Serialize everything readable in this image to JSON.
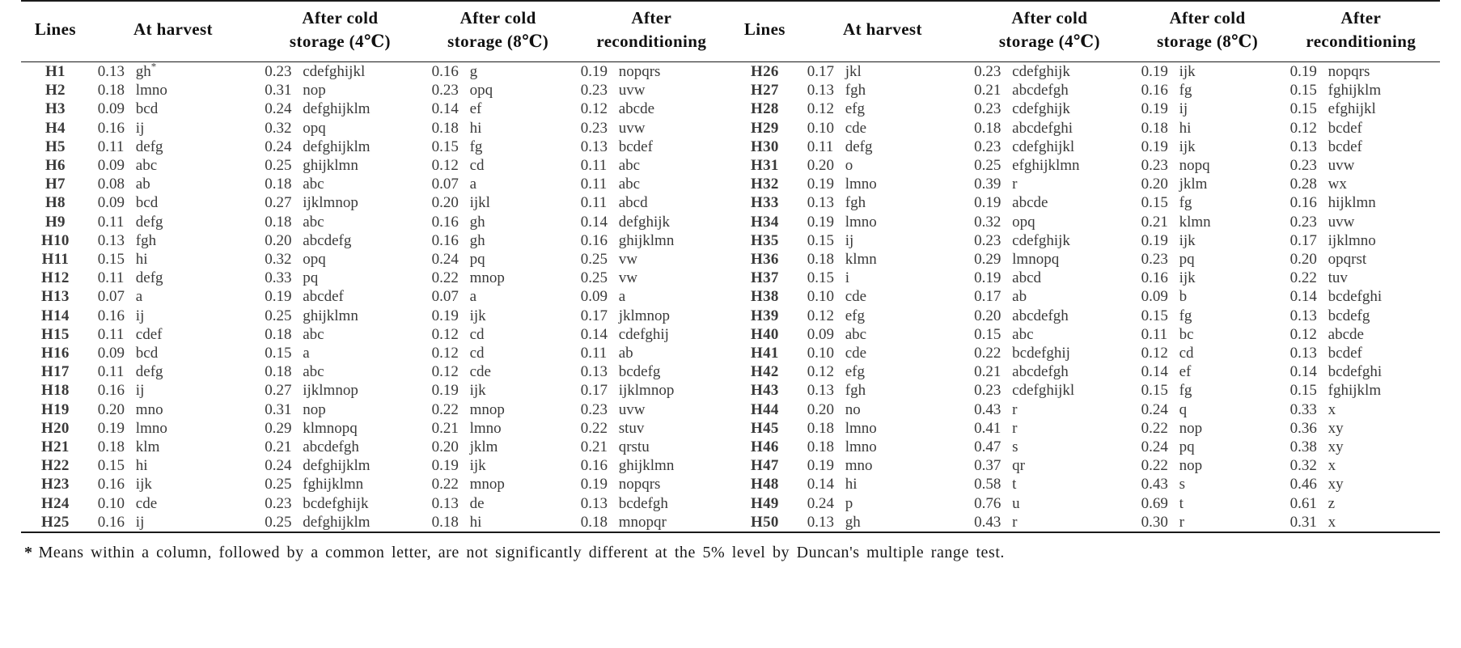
{
  "table": {
    "headers_left": [
      "Lines",
      "At harvest",
      "After cold\nstorage (4℃)",
      "After cold\nstorage (8℃)",
      "After\nreconditioning"
    ],
    "headers_right": [
      "Lines",
      "At harvest",
      "After cold\nstorage (4℃)",
      "After cold\nstorage (8℃)",
      "After\nreconditioning"
    ],
    "header_cells": {
      "lines_a": "Lines",
      "harvest_a": "At harvest",
      "cold4_a_l1": "After cold",
      "cold4_a_l2": "storage (4℃)",
      "cold8_a_l1": "After cold",
      "cold8_a_l2": "storage (8℃)",
      "recond_a_l1": "After",
      "recond_a_l2": "reconditioning",
      "lines_b": "Lines",
      "harvest_b": "At harvest",
      "cold4_b_l1": "After cold",
      "cold4_b_l2": "storage (4℃)",
      "cold8_b_l1": "After cold",
      "cold8_b_l2": "storage (8℃)",
      "recond_b_l1": "After",
      "recond_b_l2": "reconditioning"
    },
    "rows": [
      {
        "line_a": "H1",
        "h_a": "0.13",
        "hg_a": "gh",
        "h_a_star": true,
        "c4_a": "0.23",
        "c4g_a": "cdefghijkl",
        "c8_a": "0.16",
        "c8g_a": "g",
        "r_a": "0.19",
        "rg_a": "nopqrs",
        "line_b": "H26",
        "h_b": "0.17",
        "hg_b": "jkl",
        "c4_b": "0.23",
        "c4g_b": "cdefghijk",
        "c8_b": "0.19",
        "c8g_b": "ijk",
        "r_b": "0.19",
        "rg_b": "nopqrs"
      },
      {
        "line_a": "H2",
        "h_a": "0.18",
        "hg_a": "lmno",
        "c4_a": "0.31",
        "c4g_a": "nop",
        "c8_a": "0.23",
        "c8g_a": "opq",
        "r_a": "0.23",
        "rg_a": "uvw",
        "line_b": "H27",
        "h_b": "0.13",
        "hg_b": "fgh",
        "c4_b": "0.21",
        "c4g_b": "abcdefgh",
        "c8_b": "0.16",
        "c8g_b": "fg",
        "r_b": "0.15",
        "rg_b": "fghijklm"
      },
      {
        "line_a": "H3",
        "h_a": "0.09",
        "hg_a": "bcd",
        "c4_a": "0.24",
        "c4g_a": "defghijklm",
        "c8_a": "0.14",
        "c8g_a": "ef",
        "r_a": "0.12",
        "rg_a": "abcde",
        "line_b": "H28",
        "h_b": "0.12",
        "hg_b": "efg",
        "c4_b": "0.23",
        "c4g_b": "cdefghijk",
        "c8_b": "0.19",
        "c8g_b": "ij",
        "r_b": "0.15",
        "rg_b": "efghijkl"
      },
      {
        "line_a": "H4",
        "h_a": "0.16",
        "hg_a": "ij",
        "c4_a": "0.32",
        "c4g_a": "opq",
        "c8_a": "0.18",
        "c8g_a": "hi",
        "r_a": "0.23",
        "rg_a": "uvw",
        "line_b": "H29",
        "h_b": "0.10",
        "hg_b": "cde",
        "c4_b": "0.18",
        "c4g_b": "abcdefghi",
        "c8_b": "0.18",
        "c8g_b": "hi",
        "r_b": "0.12",
        "rg_b": "bcdef"
      },
      {
        "line_a": "H5",
        "h_a": "0.11",
        "hg_a": "defg",
        "c4_a": "0.24",
        "c4g_a": "defghijklm",
        "c8_a": "0.15",
        "c8g_a": "fg",
        "r_a": "0.13",
        "rg_a": "bcdef",
        "line_b": "H30",
        "h_b": "0.11",
        "hg_b": "defg",
        "c4_b": "0.23",
        "c4g_b": "cdefghijkl",
        "c8_b": "0.19",
        "c8g_b": "ijk",
        "r_b": "0.13",
        "rg_b": "bcdef"
      },
      {
        "line_a": "H6",
        "h_a": "0.09",
        "hg_a": "abc",
        "c4_a": "0.25",
        "c4g_a": "ghijklmn",
        "c8_a": "0.12",
        "c8g_a": "cd",
        "r_a": "0.11",
        "rg_a": "abc",
        "line_b": "H31",
        "h_b": "0.20",
        "hg_b": "o",
        "c4_b": "0.25",
        "c4g_b": "efghijklmn",
        "c8_b": "0.23",
        "c8g_b": "nopq",
        "r_b": "0.23",
        "rg_b": "uvw"
      },
      {
        "line_a": "H7",
        "h_a": "0.08",
        "hg_a": "ab",
        "c4_a": "0.18",
        "c4g_a": "abc",
        "c8_a": "0.07",
        "c8g_a": "a",
        "r_a": "0.11",
        "rg_a": "abc",
        "line_b": "H32",
        "h_b": "0.19",
        "hg_b": "lmno",
        "c4_b": "0.39",
        "c4g_b": "r",
        "c8_b": "0.20",
        "c8g_b": "jklm",
        "r_b": "0.28",
        "rg_b": "wx"
      },
      {
        "line_a": "H8",
        "h_a": "0.09",
        "hg_a": "bcd",
        "c4_a": "0.27",
        "c4g_a": "ijklmnop",
        "c8_a": "0.20",
        "c8g_a": "ijkl",
        "r_a": "0.11",
        "rg_a": "abcd",
        "line_b": "H33",
        "h_b": "0.13",
        "hg_b": "fgh",
        "c4_b": "0.19",
        "c4g_b": "abcde",
        "c8_b": "0.15",
        "c8g_b": "fg",
        "r_b": "0.16",
        "rg_b": "hijklmn"
      },
      {
        "line_a": "H9",
        "h_a": "0.11",
        "hg_a": "defg",
        "c4_a": "0.18",
        "c4g_a": "abc",
        "c8_a": "0.16",
        "c8g_a": "gh",
        "r_a": "0.14",
        "rg_a": "defghijk",
        "line_b": "H34",
        "h_b": "0.19",
        "hg_b": "lmno",
        "c4_b": "0.32",
        "c4g_b": "opq",
        "c8_b": "0.21",
        "c8g_b": "klmn",
        "r_b": "0.23",
        "rg_b": "uvw"
      },
      {
        "line_a": "H10",
        "h_a": "0.13",
        "hg_a": "fgh",
        "c4_a": "0.20",
        "c4g_a": "abcdefg",
        "c8_a": "0.16",
        "c8g_a": "gh",
        "r_a": "0.16",
        "rg_a": "ghijklmn",
        "line_b": "H35",
        "h_b": "0.15",
        "hg_b": "ij",
        "c4_b": "0.23",
        "c4g_b": "cdefghijk",
        "c8_b": "0.19",
        "c8g_b": "ijk",
        "r_b": "0.17",
        "rg_b": "ijklmno"
      },
      {
        "line_a": "H11",
        "h_a": "0.15",
        "hg_a": "hi",
        "c4_a": "0.32",
        "c4g_a": "opq",
        "c8_a": "0.24",
        "c8g_a": "pq",
        "r_a": "0.25",
        "rg_a": "vw",
        "line_b": "H36",
        "h_b": "0.18",
        "hg_b": "klmn",
        "c4_b": "0.29",
        "c4g_b": "lmnopq",
        "c8_b": "0.23",
        "c8g_b": "pq",
        "r_b": "0.20",
        "rg_b": "opqrst"
      },
      {
        "line_a": "H12",
        "h_a": "0.11",
        "hg_a": "defg",
        "c4_a": "0.33",
        "c4g_a": "pq",
        "c8_a": "0.22",
        "c8g_a": "mnop",
        "r_a": "0.25",
        "rg_a": "vw",
        "line_b": "H37",
        "h_b": "0.15",
        "hg_b": "i",
        "c4_b": "0.19",
        "c4g_b": "abcd",
        "c8_b": "0.16",
        "c8g_b": "ijk",
        "r_b": "0.22",
        "rg_b": "tuv"
      },
      {
        "line_a": "H13",
        "h_a": "0.07",
        "hg_a": "a",
        "c4_a": "0.19",
        "c4g_a": "abcdef",
        "c8_a": "0.07",
        "c8g_a": "a",
        "r_a": "0.09",
        "rg_a": "a",
        "line_b": "H38",
        "h_b": "0.10",
        "hg_b": "cde",
        "c4_b": "0.17",
        "c4g_b": "ab",
        "c8_b": "0.09",
        "c8g_b": "b",
        "r_b": "0.14",
        "rg_b": "bcdefghi"
      },
      {
        "line_a": "H14",
        "h_a": "0.16",
        "hg_a": "ij",
        "c4_a": "0.25",
        "c4g_a": "ghijklmn",
        "c8_a": "0.19",
        "c8g_a": "ijk",
        "r_a": "0.17",
        "rg_a": "jklmnop",
        "line_b": "H39",
        "h_b": "0.12",
        "hg_b": "efg",
        "c4_b": "0.20",
        "c4g_b": "abcdefgh",
        "c8_b": "0.15",
        "c8g_b": "fg",
        "r_b": "0.13",
        "rg_b": "bcdefg"
      },
      {
        "line_a": "H15",
        "h_a": "0.11",
        "hg_a": "cdef",
        "c4_a": "0.18",
        "c4g_a": "abc",
        "c8_a": "0.12",
        "c8g_a": "cd",
        "r_a": "0.14",
        "rg_a": "cdefghij",
        "line_b": "H40",
        "h_b": "0.09",
        "hg_b": "abc",
        "c4_b": "0.15",
        "c4g_b": "abc",
        "c8_b": "0.11",
        "c8g_b": "bc",
        "r_b": "0.12",
        "rg_b": "abcde"
      },
      {
        "line_a": "H16",
        "h_a": "0.09",
        "hg_a": "bcd",
        "c4_a": "0.15",
        "c4g_a": "a",
        "c8_a": "0.12",
        "c8g_a": "cd",
        "r_a": "0.11",
        "rg_a": "ab",
        "line_b": "H41",
        "h_b": "0.10",
        "hg_b": "cde",
        "c4_b": "0.22",
        "c4g_b": "bcdefghij",
        "c8_b": "0.12",
        "c8g_b": "cd",
        "r_b": "0.13",
        "rg_b": "bcdef"
      },
      {
        "line_a": "H17",
        "h_a": "0.11",
        "hg_a": "defg",
        "c4_a": "0.18",
        "c4g_a": "abc",
        "c8_a": "0.12",
        "c8g_a": "cde",
        "r_a": "0.13",
        "rg_a": "bcdefg",
        "line_b": "H42",
        "h_b": "0.12",
        "hg_b": "efg",
        "c4_b": "0.21",
        "c4g_b": "abcdefgh",
        "c8_b": "0.14",
        "c8g_b": "ef",
        "r_b": "0.14",
        "rg_b": "bcdefghi"
      },
      {
        "line_a": "H18",
        "h_a": "0.16",
        "hg_a": "ij",
        "c4_a": "0.27",
        "c4g_a": "ijklmnop",
        "c8_a": "0.19",
        "c8g_a": "ijk",
        "r_a": "0.17",
        "rg_a": "ijklmnop",
        "line_b": "H43",
        "h_b": "0.13",
        "hg_b": "fgh",
        "c4_b": "0.23",
        "c4g_b": "cdefghijkl",
        "c8_b": "0.15",
        "c8g_b": "fg",
        "r_b": "0.15",
        "rg_b": "fghijklm"
      },
      {
        "line_a": "H19",
        "h_a": "0.20",
        "hg_a": "mno",
        "c4_a": "0.31",
        "c4g_a": "nop",
        "c8_a": "0.22",
        "c8g_a": "mnop",
        "r_a": "0.23",
        "rg_a": "uvw",
        "line_b": "H44",
        "h_b": "0.20",
        "hg_b": "no",
        "c4_b": "0.43",
        "c4g_b": "r",
        "c8_b": "0.24",
        "c8g_b": "q",
        "r_b": "0.33",
        "rg_b": "x"
      },
      {
        "line_a": "H20",
        "h_a": "0.19",
        "hg_a": "lmno",
        "c4_a": "0.29",
        "c4g_a": "klmnopq",
        "c8_a": "0.21",
        "c8g_a": "lmno",
        "r_a": "0.22",
        "rg_a": "stuv",
        "line_b": "H45",
        "h_b": "0.18",
        "hg_b": "lmno",
        "c4_b": "0.41",
        "c4g_b": "r",
        "c8_b": "0.22",
        "c8g_b": "nop",
        "r_b": "0.36",
        "rg_b": "xy"
      },
      {
        "line_a": "H21",
        "h_a": "0.18",
        "hg_a": "klm",
        "c4_a": "0.21",
        "c4g_a": "abcdefgh",
        "c8_a": "0.20",
        "c8g_a": "jklm",
        "r_a": "0.21",
        "rg_a": "qrstu",
        "line_b": "H46",
        "h_b": "0.18",
        "hg_b": "lmno",
        "c4_b": "0.47",
        "c4g_b": "s",
        "c8_b": "0.24",
        "c8g_b": "pq",
        "r_b": "0.38",
        "rg_b": "xy"
      },
      {
        "line_a": "H22",
        "h_a": "0.15",
        "hg_a": "hi",
        "c4_a": "0.24",
        "c4g_a": "defghijklm",
        "c8_a": "0.19",
        "c8g_a": "ijk",
        "r_a": "0.16",
        "rg_a": "ghijklmn",
        "line_b": "H47",
        "h_b": "0.19",
        "hg_b": "mno",
        "c4_b": "0.37",
        "c4g_b": "qr",
        "c8_b": "0.22",
        "c8g_b": "nop",
        "r_b": "0.32",
        "rg_b": "x"
      },
      {
        "line_a": "H23",
        "h_a": "0.16",
        "hg_a": "ijk",
        "c4_a": "0.25",
        "c4g_a": "fghijklmn",
        "c8_a": "0.22",
        "c8g_a": "mnop",
        "r_a": "0.19",
        "rg_a": "nopqrs",
        "line_b": "H48",
        "h_b": "0.14",
        "hg_b": "hi",
        "c4_b": "0.58",
        "c4g_b": "t",
        "c8_b": "0.43",
        "c8g_b": "s",
        "r_b": "0.46",
        "rg_b": "xy"
      },
      {
        "line_a": "H24",
        "h_a": "0.10",
        "hg_a": "cde",
        "c4_a": "0.23",
        "c4g_a": "bcdefghijk",
        "c8_a": "0.13",
        "c8g_a": "de",
        "r_a": "0.13",
        "rg_a": "bcdefgh",
        "line_b": "H49",
        "h_b": "0.24",
        "hg_b": "p",
        "c4_b": "0.76",
        "c4g_b": "u",
        "c8_b": "0.69",
        "c8g_b": "t",
        "r_b": "0.61",
        "rg_b": "z"
      },
      {
        "line_a": "H25",
        "h_a": "0.16",
        "hg_a": "ij",
        "c4_a": "0.25",
        "c4g_a": "defghijklm",
        "c8_a": "0.18",
        "c8g_a": "hi",
        "r_a": "0.18",
        "rg_a": "mnopqr",
        "line_b": "H50",
        "h_b": "0.13",
        "hg_b": "gh",
        "c4_b": "0.43",
        "c4g_b": "r",
        "c8_b": "0.30",
        "c8g_b": "r",
        "r_b": "0.31",
        "rg_b": "x"
      }
    ]
  },
  "footnote": {
    "marker": "*",
    "text": "Means within a column, followed by a common letter, are not significantly different at the 5% level by Duncan's multiple range test."
  }
}
